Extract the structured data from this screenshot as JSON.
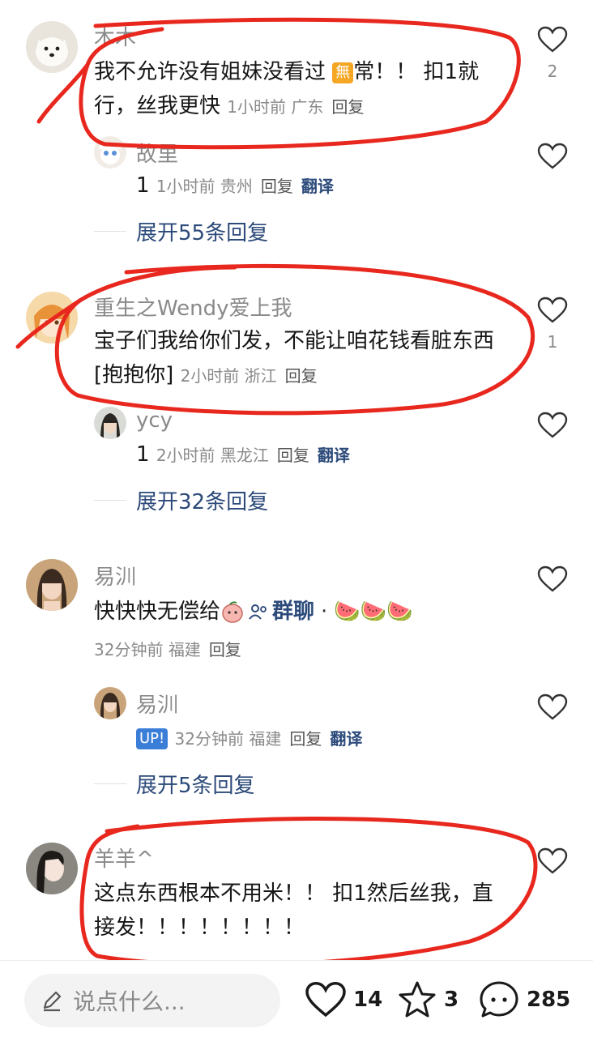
{
  "comments": [
    {
      "username": "木木",
      "text_a": "我不允许没有姐妹没看过 ",
      "badge": "無",
      "text_b": "常！！ 扣1就行，丝我更快",
      "time": "1小时前",
      "location": "广东",
      "reply_label": "回复",
      "likes": "2",
      "reply": {
        "username": "故里",
        "text": "1",
        "time": "1小时前",
        "location": "贵州",
        "reply_label": "回复",
        "translate_label": "翻译"
      },
      "expand_label": "展开55条回复"
    },
    {
      "username": "重生之Wendy爱上我",
      "text": "宝子们我给你们发，不能让咱花钱看脏东西[抱抱你]",
      "time": "2小时前",
      "location": "浙江",
      "reply_label": "回复",
      "likes": "1",
      "reply": {
        "username": "ycy",
        "text": "1",
        "time": "2小时前",
        "location": "黑龙江",
        "reply_label": "回复",
        "translate_label": "翻译"
      },
      "expand_label": "展开32条回复"
    },
    {
      "username": "易汌",
      "text": "快快快无偿给",
      "group_chat_label": "群聊",
      "emoji": "🍉🍉🍉",
      "time": "32分钟前",
      "location": "福建",
      "reply_label": "回复",
      "reply": {
        "username": "易汌",
        "badge": "UP!",
        "time": "32分钟前",
        "location": "福建",
        "reply_label": "回复",
        "translate_label": "翻译"
      },
      "expand_label": "展开5条回复"
    },
    {
      "username": "羊羊^",
      "text": "这点东西根本不用米！！ 扣1然后丝我，直接发！！！！！！！！"
    }
  ],
  "bottom_bar": {
    "input_placeholder": "说点什么...",
    "like_count": "14",
    "star_count": "3",
    "comment_count": "285"
  },
  "colors": {
    "annotation_red": "#e8281e",
    "link_blue": "#2c4a7a",
    "meta_gray": "#8a8a8a"
  }
}
